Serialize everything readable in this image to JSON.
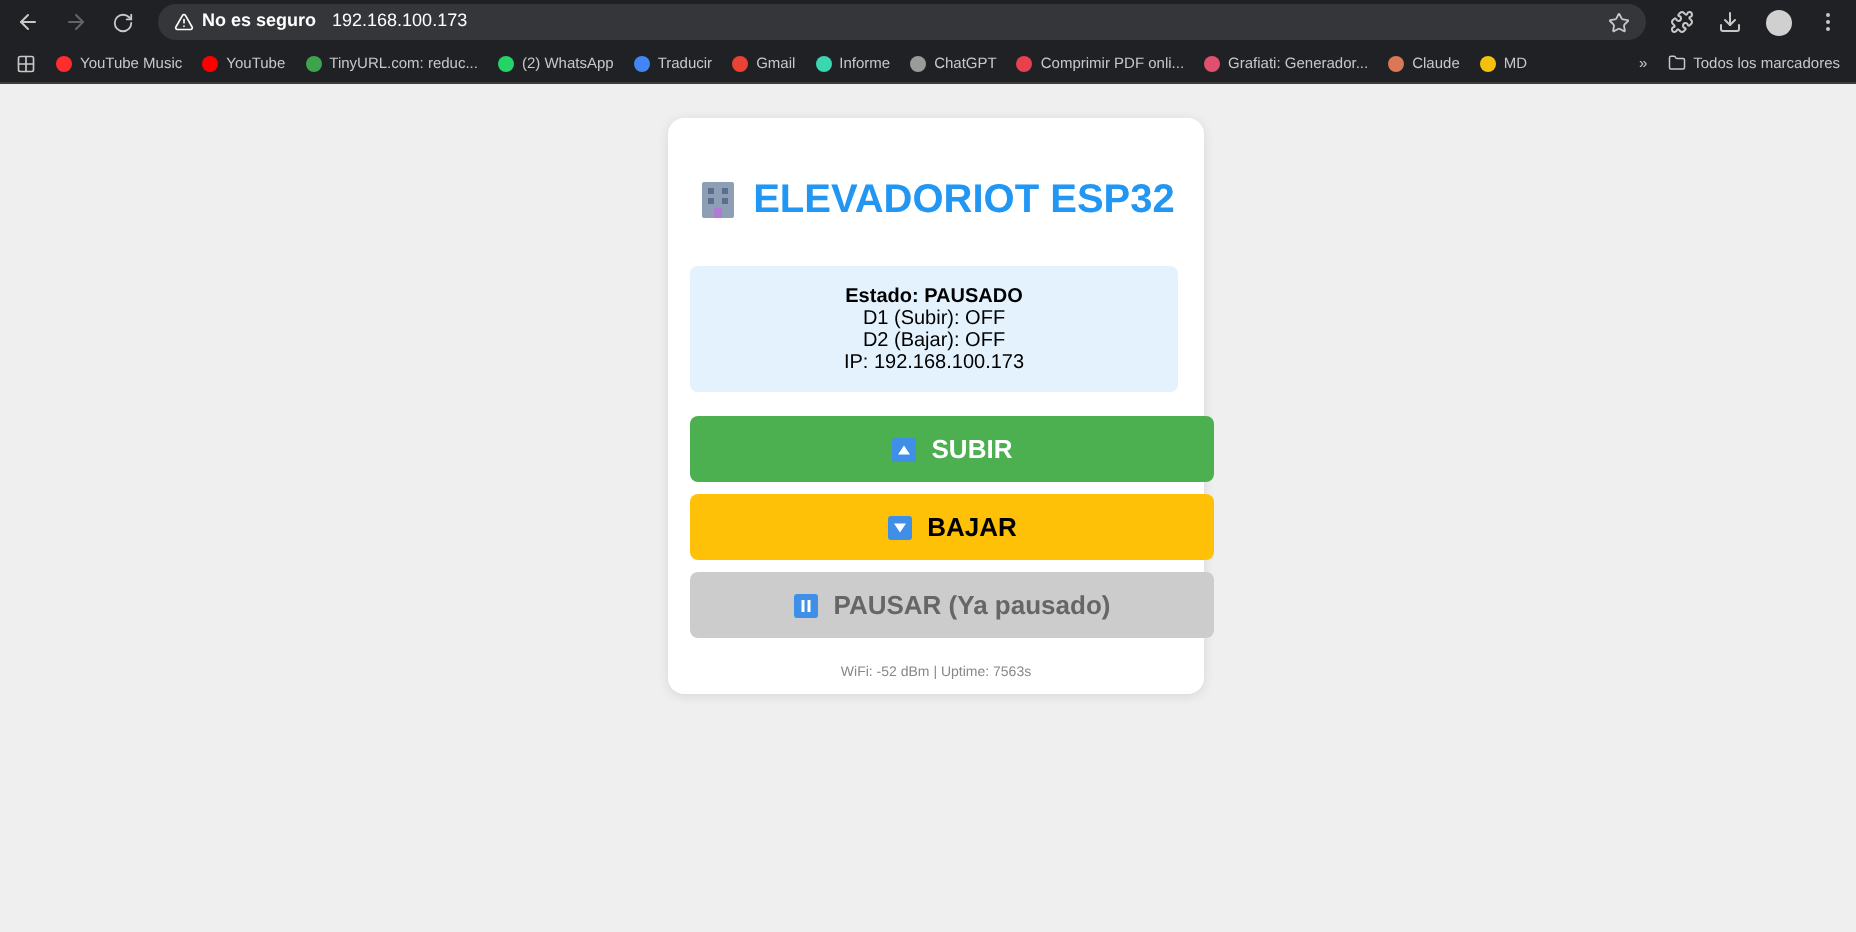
{
  "browser": {
    "security_label": "No es seguro",
    "url": "192.168.100.173",
    "bookmarks": [
      {
        "label": "YouTube Music",
        "color": "#ff2d2d"
      },
      {
        "label": "YouTube",
        "color": "#ff0000"
      },
      {
        "label": "TinyURL.com: reduc...",
        "color": "#3fa34d"
      },
      {
        "label": "(2) WhatsApp",
        "color": "#25d366"
      },
      {
        "label": "Traducir",
        "color": "#4285f4"
      },
      {
        "label": "Gmail",
        "color": "#ea4335"
      },
      {
        "label": "Informe",
        "color": "#3ad6b0"
      },
      {
        "label": "ChatGPT",
        "color": "#9a9a9a"
      },
      {
        "label": "Comprimir PDF onli...",
        "color": "#e8404f"
      },
      {
        "label": "Grafiati: Generador...",
        "color": "#e0506e"
      },
      {
        "label": "Claude",
        "color": "#d97757"
      },
      {
        "label": "MD",
        "color": "#f4c20d"
      }
    ],
    "overflow": "»",
    "all_bookmarks": "Todos los marcadores"
  },
  "card": {
    "title": "ELEVADORIOT ESP32",
    "status": {
      "state": "Estado: PAUSADO",
      "lines": [
        "D1 (Subir): OFF",
        "D2 (Bajar): OFF",
        "IP: 192.168.100.173"
      ]
    },
    "buttons": [
      {
        "kind": "up",
        "label": "SUBIR",
        "disabled": false
      },
      {
        "kind": "down",
        "label": "BAJAR",
        "disabled": false
      },
      {
        "kind": "pause",
        "label": "PAUSAR (Ya pausado)",
        "disabled": true
      }
    ],
    "footer": "WiFi: -52 dBm | Uptime: 7563s"
  }
}
